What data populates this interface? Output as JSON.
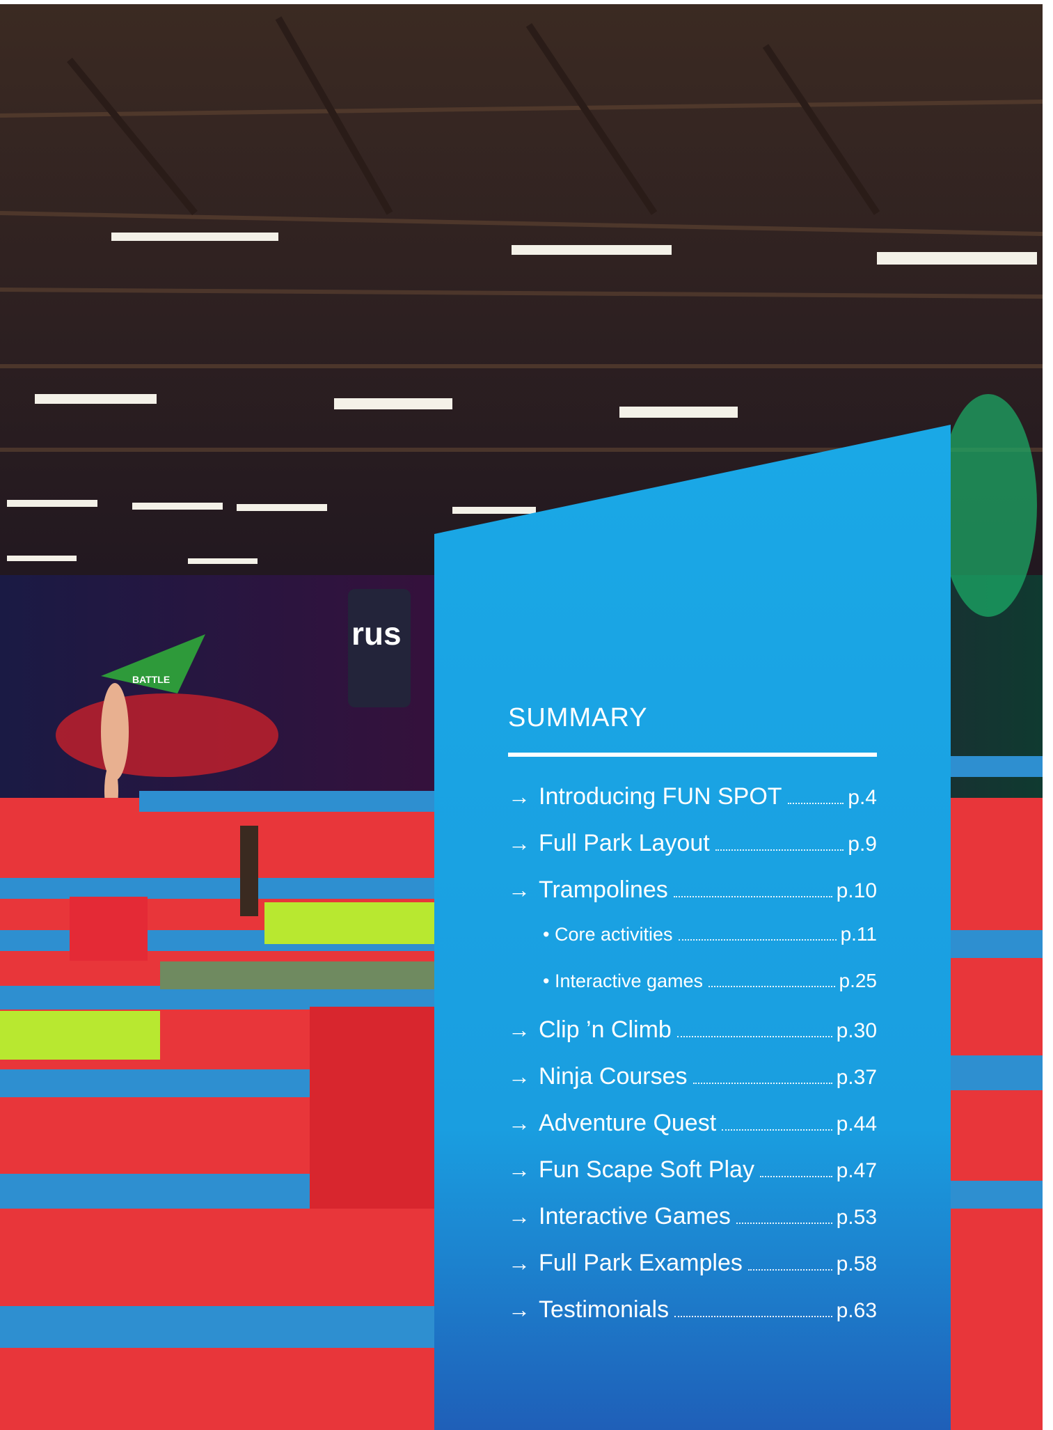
{
  "summary": {
    "title": "SUMMARY",
    "items": [
      {
        "label": "Introducing FUN SPOT",
        "page": "p.4",
        "level": 1
      },
      {
        "label": "Full Park Layout",
        "page": "p.9",
        "level": 1
      },
      {
        "label": "Trampolines",
        "page": "p.10",
        "level": 1
      },
      {
        "label": "• Core activities",
        "page": "p.11",
        "level": 2
      },
      {
        "label": "• Interactive games",
        "page": "p.25",
        "level": 2
      },
      {
        "label": "Clip ’n Climb",
        "page": "p.30",
        "level": 1
      },
      {
        "label": "Ninja Courses",
        "page": "p.37",
        "level": 1
      },
      {
        "label": "Adventure Quest",
        "page": "p.44",
        "level": 1
      },
      {
        "label": "Fun Scape Soft Play",
        "page": "p.47",
        "level": 1
      },
      {
        "label": "Interactive Games",
        "page": "p.53",
        "level": 1
      },
      {
        "label": "Full Park Examples",
        "page": "p.58",
        "level": 1
      },
      {
        "label": "Testimonials",
        "page": "p.63",
        "level": 1
      }
    ]
  },
  "photo": {
    "sign_battle": "BATTLE",
    "bag_text": "rus"
  },
  "colors": {
    "panel_top": "#1aa8e6",
    "panel_bottom": "#1f5fb8",
    "text": "#ffffff"
  }
}
